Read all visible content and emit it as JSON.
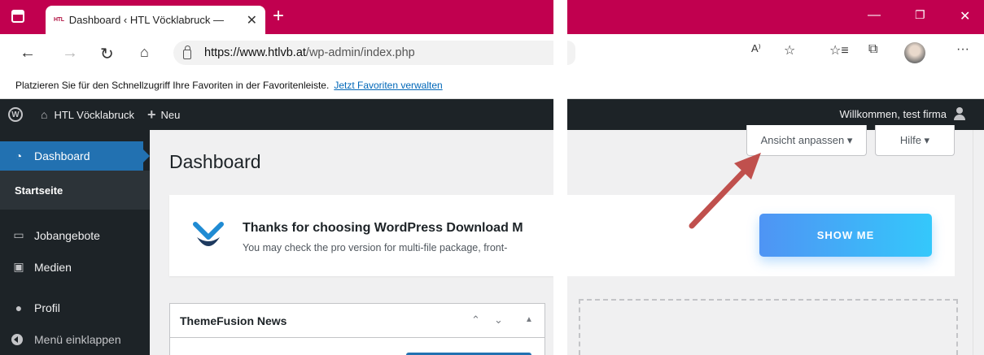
{
  "browser": {
    "tab_title": "Dashboard ‹ HTL Vöcklabruck —",
    "tab_favicon_text": "HTL",
    "url_host": "https://www.htlvb.at",
    "url_path": "/wp-admin/index.php",
    "favorites_prompt": "Platzieren Sie für den Schnellzugriff Ihre Favoriten in der Favoritenleiste.",
    "favorites_link": "Jetzt Favoriten verwalten",
    "accent_color": "#c1004f"
  },
  "adminbar": {
    "site_name": "HTL Vöcklabruck",
    "new_label": "Neu",
    "welcome": "Willkommen, test firma"
  },
  "sidebar": {
    "active": "Dashboard",
    "submenu": "Startseite",
    "items": [
      {
        "label": "Jobangebote",
        "icon": "jobs-icon"
      },
      {
        "label": "Medien",
        "icon": "media-icon"
      },
      {
        "label": "Profil",
        "icon": "profile-icon"
      },
      {
        "label": "Menü einklappen",
        "icon": "collapse-icon"
      }
    ]
  },
  "main": {
    "page_title": "Dashboard",
    "notice_title": "Thanks for choosing WordPress Download M",
    "notice_text": "You may check the pro version for multi-file package, front-",
    "news_title": "ThemeFusion News",
    "screen_options": "Ansicht anpassen ▾",
    "help": "Hilfe ▾",
    "show_me": "SHOW ME"
  },
  "annotation": {
    "arrow_color": "#c0504d"
  }
}
